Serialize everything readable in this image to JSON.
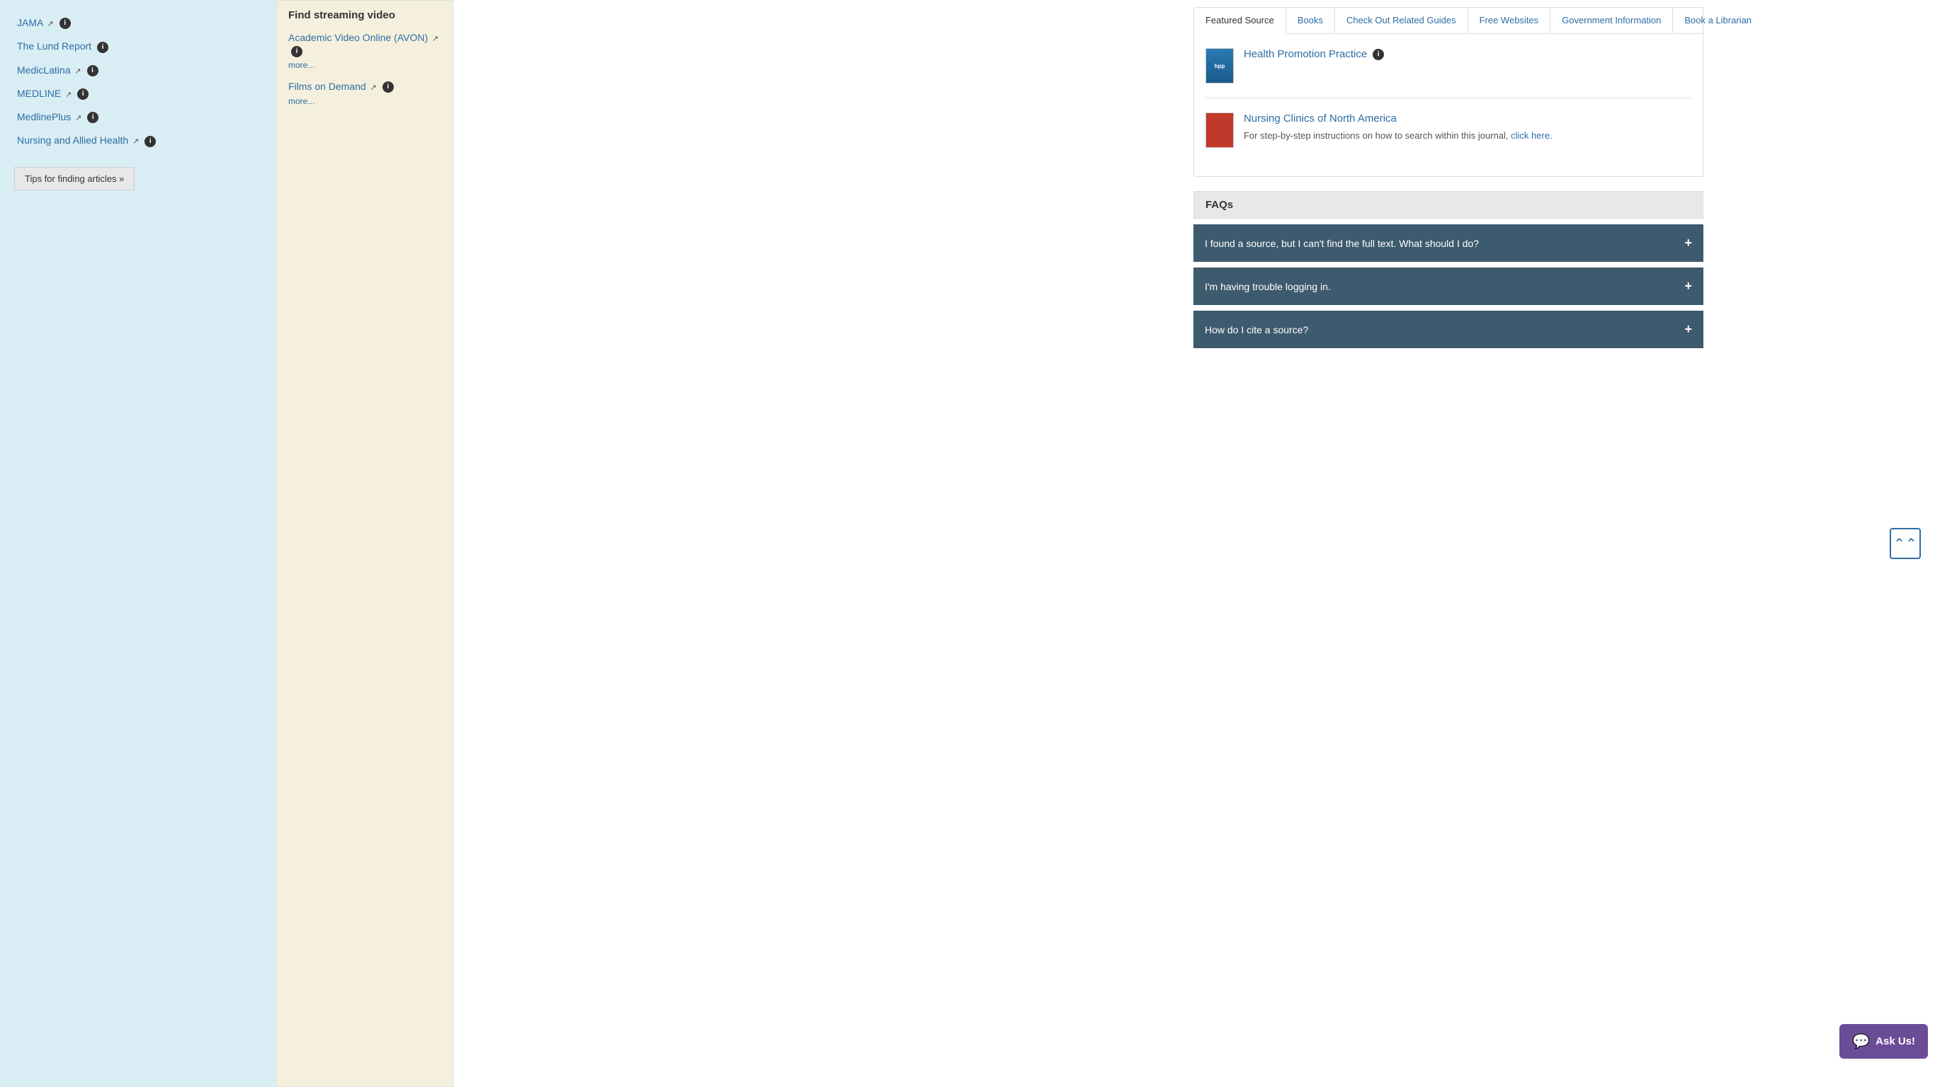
{
  "left_panel": {
    "resources": [
      {
        "name": "JAMA",
        "hasExt": true,
        "hasInfo": true
      },
      {
        "name": "The Lund Report",
        "hasExt": false,
        "hasInfo": true
      },
      {
        "name": "MedicLatina",
        "hasExt": true,
        "hasInfo": true
      },
      {
        "name": "MEDLINE",
        "hasExt": true,
        "hasInfo": true
      },
      {
        "name": "MedlinePlus",
        "hasExt": true,
        "hasInfo": true
      },
      {
        "name": "Nursing and Allied Health",
        "hasExt": true,
        "hasInfo": true
      }
    ],
    "tips_button": "Tips for finding articles »"
  },
  "streaming_panel": {
    "title": "Find streaming video",
    "items": [
      {
        "name": "Academic Video Online (AVON)",
        "hasExt": true,
        "hasInfo": true,
        "more": "more..."
      },
      {
        "name": "Films on Demand",
        "hasExt": true,
        "hasInfo": true,
        "more": "more..."
      }
    ]
  },
  "tabs": {
    "items": [
      {
        "label": "Featured Source",
        "active": true
      },
      {
        "label": "Books",
        "active": false
      },
      {
        "label": "Check Out Related Guides",
        "active": false
      },
      {
        "label": "Free Websites",
        "active": false
      },
      {
        "label": "Government Information",
        "active": false
      },
      {
        "label": "Book a Librarian",
        "active": false
      }
    ],
    "featured": {
      "items": [
        {
          "title": "Health Promotion Practice",
          "cover_text": "hpp",
          "cover_color": "#2a7ab5",
          "has_info": true,
          "description": ""
        },
        {
          "title": "Nursing Clinics of North America",
          "cover_color": "#c0392b",
          "has_info": false,
          "description": "For step-by-step instructions on how to search within this journal,",
          "link_text": "click here.",
          "link_href": "#"
        }
      ]
    }
  },
  "faqs": {
    "header": "FAQs",
    "items": [
      {
        "question": "I found a source, but I can't find the full text. What should I do?"
      },
      {
        "question": "I'm having trouble logging in."
      },
      {
        "question": "How do I cite a source?"
      }
    ]
  },
  "back_to_top": "↑",
  "ask_us": {
    "label": "Ask Us!",
    "icon": "💬"
  }
}
